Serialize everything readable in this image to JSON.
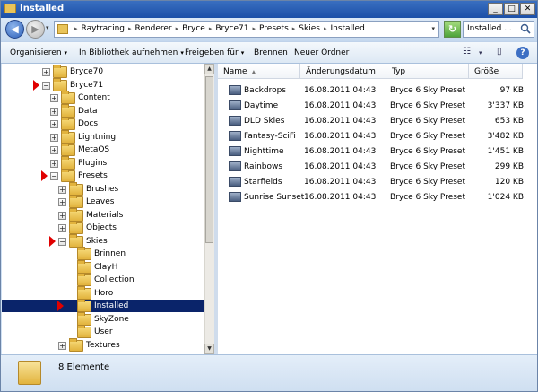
{
  "window": {
    "title": "Installed",
    "minimize": "_",
    "maximize": "□",
    "close": "✕"
  },
  "nav": {
    "back": "◀",
    "forward": "▶",
    "dropdown": "▾"
  },
  "breadcrumb": [
    "Raytracing",
    "Renderer",
    "Bryce",
    "Bryce71",
    "Presets",
    "Skies",
    "Installed"
  ],
  "search": {
    "value": "Installed ..."
  },
  "toolbar": {
    "organize": "Organisieren",
    "library": "In Bibliothek aufnehmen",
    "share": "Freigeben für",
    "burn": "Brennen",
    "new_folder": "Neuer Ordner"
  },
  "tree": [
    {
      "label": "Bryce70",
      "expander": "+",
      "marker": false,
      "selected": false
    },
    {
      "label": "Bryce71",
      "expander": "−",
      "marker": true,
      "selected": false
    },
    {
      "label": "Content",
      "expander": "+",
      "marker": false,
      "selected": false
    },
    {
      "label": "Data",
      "expander": "+",
      "marker": false,
      "selected": false
    },
    {
      "label": "Docs",
      "expander": "+",
      "marker": false,
      "selected": false
    },
    {
      "label": "Lightning",
      "expander": "+",
      "marker": false,
      "selected": false
    },
    {
      "label": "MetaOS",
      "expander": "+",
      "marker": false,
      "selected": false
    },
    {
      "label": "Plugins",
      "expander": "+",
      "marker": false,
      "selected": false
    },
    {
      "label": "Presets",
      "expander": "−",
      "marker": true,
      "selected": false
    },
    {
      "label": "Brushes",
      "expander": "+",
      "marker": false,
      "selected": false
    },
    {
      "label": "Leaves",
      "expander": "+",
      "marker": false,
      "selected": false
    },
    {
      "label": "Materials",
      "expander": "+",
      "marker": false,
      "selected": false
    },
    {
      "label": "Objects",
      "expander": "+",
      "marker": false,
      "selected": false
    },
    {
      "label": "Skies",
      "expander": "−",
      "marker": true,
      "selected": false
    },
    {
      "label": "Brinnen",
      "expander": "",
      "marker": false,
      "selected": false
    },
    {
      "label": "ClayH",
      "expander": "",
      "marker": false,
      "selected": false
    },
    {
      "label": "Collection",
      "expander": "",
      "marker": false,
      "selected": false
    },
    {
      "label": "Horo",
      "expander": "",
      "marker": false,
      "selected": false
    },
    {
      "label": "Installed",
      "expander": "",
      "marker": true,
      "selected": true
    },
    {
      "label": "SkyZone",
      "expander": "",
      "marker": false,
      "selected": false
    },
    {
      "label": "User",
      "expander": "",
      "marker": false,
      "selected": false
    },
    {
      "label": "Textures",
      "expander": "+",
      "marker": false,
      "selected": false
    }
  ],
  "columns": {
    "name": "Name",
    "date": "Änderungsdatum",
    "type": "Typ",
    "size": "Größe"
  },
  "files": [
    {
      "name": "Backdrops",
      "date": "16.08.2011 04:43",
      "type": "Bryce 6 Sky Preset",
      "size": "97 KB"
    },
    {
      "name": "Daytime",
      "date": "16.08.2011 04:43",
      "type": "Bryce 6 Sky Preset",
      "size": "3'337 KB"
    },
    {
      "name": "DLD Skies",
      "date": "16.08.2011 04:43",
      "type": "Bryce 6 Sky Preset",
      "size": "653 KB"
    },
    {
      "name": "Fantasy-SciFi",
      "date": "16.08.2011 04:43",
      "type": "Bryce 6 Sky Preset",
      "size": "3'482 KB"
    },
    {
      "name": "Nighttime",
      "date": "16.08.2011 04:43",
      "type": "Bryce 6 Sky Preset",
      "size": "1'451 KB"
    },
    {
      "name": "Rainbows",
      "date": "16.08.2011 04:43",
      "type": "Bryce 6 Sky Preset",
      "size": "299 KB"
    },
    {
      "name": "Starfields",
      "date": "16.08.2011 04:43",
      "type": "Bryce 6 Sky Preset",
      "size": "120 KB"
    },
    {
      "name": "Sunrise Sunset",
      "date": "16.08.2011 04:43",
      "type": "Bryce 6 Sky Preset",
      "size": "1'024 KB"
    }
  ],
  "status": {
    "count": "8 Elemente"
  }
}
